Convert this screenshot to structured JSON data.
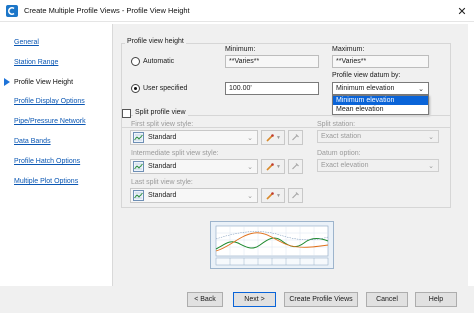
{
  "window": {
    "title": "Create Multiple Profile Views - Profile View Height",
    "close_glyph": "✕"
  },
  "sidebar": {
    "items": [
      {
        "label": "General",
        "active": false
      },
      {
        "label": "Station Range",
        "active": false
      },
      {
        "label": "Profile View Height",
        "active": true
      },
      {
        "label": "Profile Display Options",
        "active": false
      },
      {
        "label": "Pipe/Pressure Network",
        "active": false
      },
      {
        "label": "Data Bands",
        "active": false
      },
      {
        "label": "Profile Hatch Options",
        "active": false
      },
      {
        "label": "Multiple Plot Options",
        "active": false
      }
    ]
  },
  "height": {
    "group_label": "Profile view height",
    "automatic_label": "Automatic",
    "user_specified_label": "User specified",
    "user_specified_selected": true,
    "minimum_label": "Minimum:",
    "minimum_value": "**Varies**",
    "maximum_label": "Maximum:",
    "maximum_value": "**Varies**",
    "user_value": "100.00'",
    "datum_label": "Profile view datum by:",
    "datum_value": "Minimum elevation",
    "datum_options": [
      "Minimum elevation",
      "Mean elevation"
    ],
    "datum_highlighted_index": 0
  },
  "split": {
    "checkbox_label": "Split profile view",
    "checked": false,
    "first_style_label": "First split view style:",
    "first_style_value": "Standard",
    "split_station_label": "Split station:",
    "split_station_value": "Exact station",
    "intermediate_style_label": "Intermediate split view style:",
    "intermediate_style_value": "Standard",
    "datum_option_label": "Datum option:",
    "datum_option_value": "Exact elevation",
    "last_style_label": "Last split view style:",
    "last_style_value": "Standard"
  },
  "footer": {
    "back_label": "< Back",
    "next_label": "Next >",
    "create_label": "Create Profile Views",
    "cancel_label": "Cancel",
    "help_label": "Help"
  },
  "colors": {
    "link": "#0b57b3",
    "accent": "#0a64d8",
    "preview_ground": "#1f8a2e",
    "preview_line": "#e0701a"
  },
  "icons": {
    "app": "civil3d-app-icon",
    "style": "profile-view-style-icon",
    "edit": "edit-style-icon",
    "details": "style-details-icon",
    "nav_pointer": "current-page-arrow-icon"
  }
}
